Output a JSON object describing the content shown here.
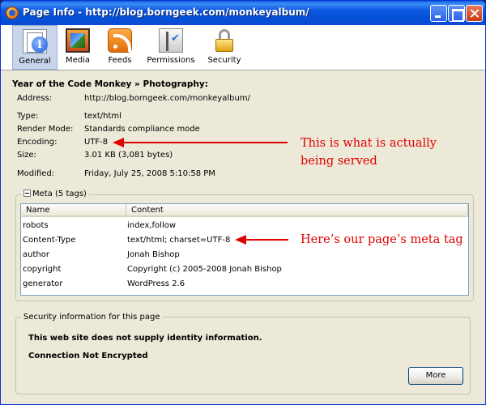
{
  "window": {
    "title": "Page Info - http://blog.borngeek.com/monkeyalbum/"
  },
  "toolbar": {
    "general": "General",
    "media": "Media",
    "feeds": "Feeds",
    "permissions": "Permissions",
    "security": "Security"
  },
  "general": {
    "site_title": "Year of the Code Monkey » Photography:",
    "address_label": "Address:",
    "address_value": "http://blog.borngeek.com/monkeyalbum/",
    "type_label": "Type:",
    "type_value": "text/html",
    "render_label": "Render Mode:",
    "render_value": "Standards compliance mode",
    "encoding_label": "Encoding:",
    "encoding_value": "UTF-8",
    "size_label": "Size:",
    "size_value": "3.01 KB (3,081 bytes)",
    "modified_label": "Modified:",
    "modified_value": "Friday, July 25, 2008 5:10:58 PM"
  },
  "annotations": {
    "served_line1": "This is what is actually",
    "served_line2": "being served",
    "meta_tag": "Here’s our page’s meta tag",
    "color": "#e00000"
  },
  "meta": {
    "title": "Meta (5 tags)",
    "col_name": "Name",
    "col_content": "Content",
    "rows": [
      {
        "name": "robots",
        "content": "index,follow"
      },
      {
        "name": "Content-Type",
        "content": "text/html; charset=UTF-8"
      },
      {
        "name": "author",
        "content": "Jonah Bishop"
      },
      {
        "name": "copyright",
        "content": "Copyright (c) 2005-2008 Jonah Bishop"
      },
      {
        "name": "generator",
        "content": "WordPress 2.6"
      }
    ]
  },
  "security": {
    "title": "Security information for this page",
    "identity": "This web site does not supply identity information.",
    "encryption": "Connection Not Encrypted",
    "more": "More"
  }
}
